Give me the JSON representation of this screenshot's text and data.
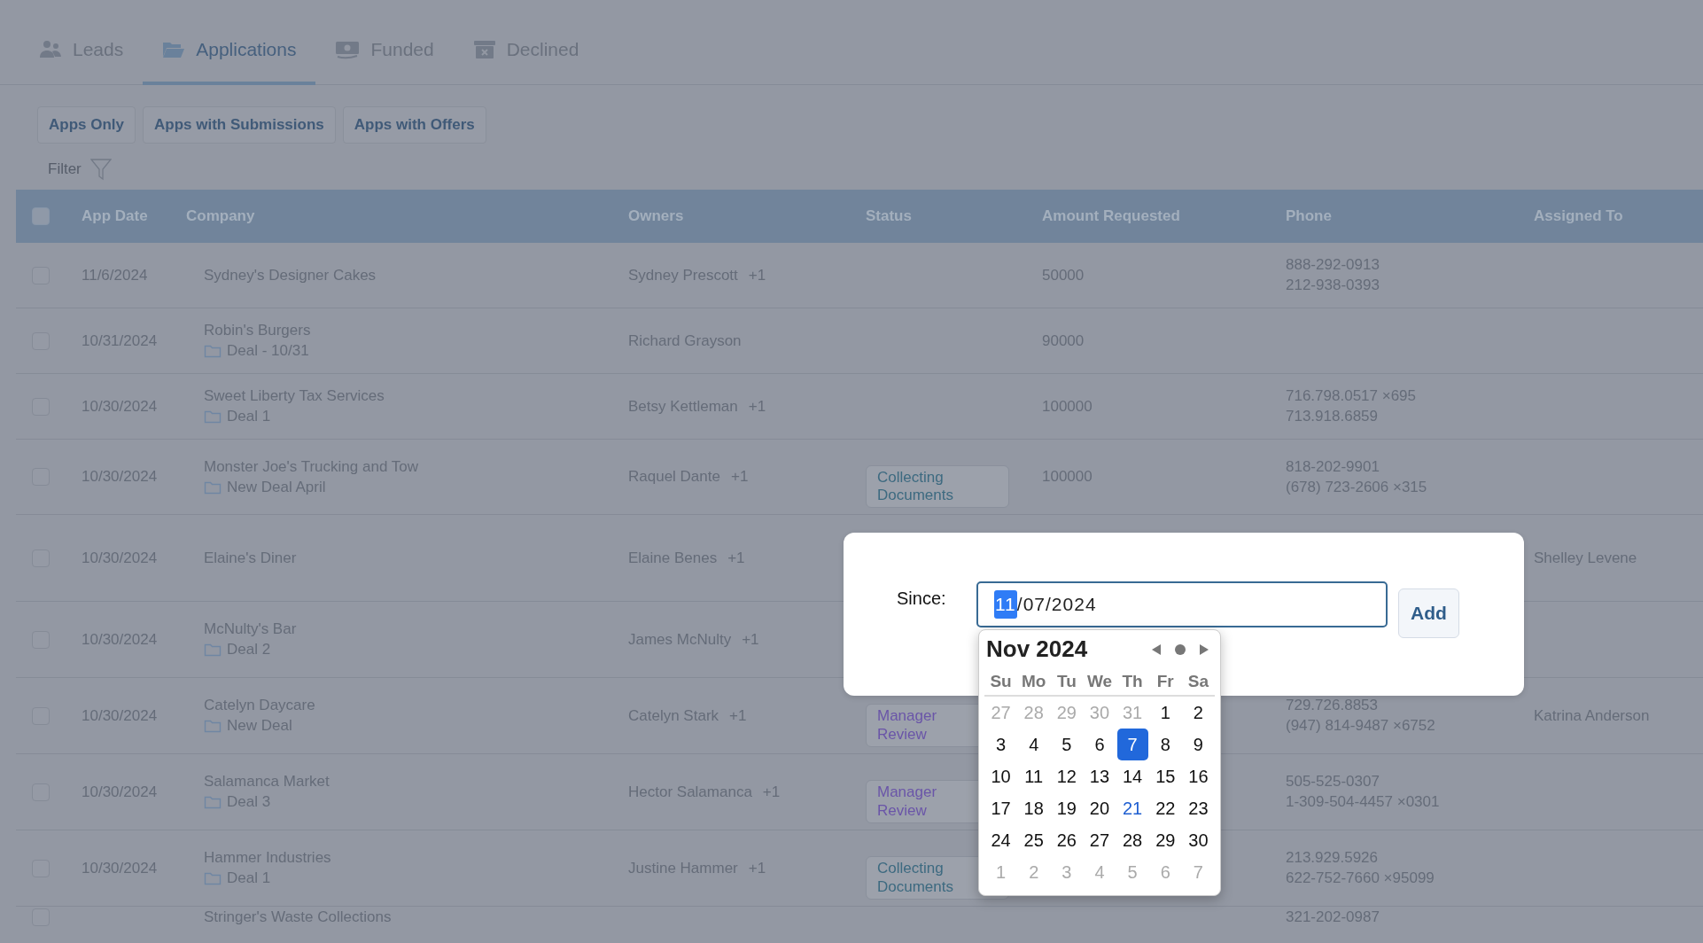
{
  "tabs": [
    {
      "label": "Leads",
      "selected": false
    },
    {
      "label": "Applications",
      "selected": true
    },
    {
      "label": "Funded",
      "selected": false
    },
    {
      "label": "Declined",
      "selected": false
    }
  ],
  "segments": [
    "Apps Only",
    "Apps with Submissions",
    "Apps with Offers"
  ],
  "filter": {
    "label": "Filter"
  },
  "table": {
    "all_checked": false,
    "columns": [
      "App Date",
      "Company",
      "Owners",
      "Status",
      "Amount Requested",
      "Phone",
      "Assigned To"
    ],
    "rows": [
      {
        "checked": false,
        "date": "11/6/2024",
        "company": "Sydney's Designer Cakes",
        "owner": "Sydney Prescott",
        "owner_extra": "+1",
        "amount": "50000",
        "phones": [
          "888-292-0913",
          "212-938-0393"
        ]
      },
      {
        "checked": false,
        "date": "10/31/2024",
        "company": "Robin's Burgers",
        "deal": "Deal - 10/31",
        "owner": "Richard Grayson",
        "amount": "90000"
      },
      {
        "checked": false,
        "date": "10/30/2024",
        "company": "Sweet Liberty Tax Services",
        "deal": "Deal 1",
        "owner": "Betsy Kettleman",
        "owner_extra": "+1",
        "amount": "100000",
        "phones": [
          "716.798.0517 ×695",
          "713.918.6859"
        ]
      },
      {
        "checked": false,
        "date": "10/30/2024",
        "company": "Monster Joe's Trucking and Tow",
        "deal": "New Deal April",
        "owner": "Raquel Dante",
        "owner_extra": "+1",
        "status": {
          "label": "Collecting Documents",
          "color": "#3d6a80"
        },
        "amount": "100000",
        "phones": [
          "818-202-9901",
          "(678) 723-2606 ×315"
        ]
      },
      {
        "checked": false,
        "date": "10/30/2024",
        "company": "Elaine's Diner",
        "owner": "Elaine Benes",
        "owner_extra": "+1",
        "assigned": "Shelley Levene"
      },
      {
        "checked": false,
        "date": "10/30/2024",
        "company": "McNulty's Bar",
        "deal": "Deal 2",
        "owner": "James McNulty",
        "owner_extra": "+1"
      },
      {
        "checked": false,
        "date": "10/30/2024",
        "company": "Catelyn Daycare",
        "deal": "New Deal",
        "owner": "Catelyn Stark",
        "owner_extra": "+1",
        "status": {
          "label": "Manager Review",
          "color": "#6a55a8"
        },
        "phones": [
          "729.726.8853",
          "(947) 814-9487 ×6752"
        ],
        "assigned": "Katrina Anderson"
      },
      {
        "checked": false,
        "date": "10/30/2024",
        "company": "Salamanca Market",
        "deal": "Deal 3",
        "owner": "Hector Salamanca",
        "owner_extra": "+1",
        "status": {
          "label": "Manager Review",
          "color": "#6a55a8"
        },
        "phones": [
          "505-525-0307",
          "1-309-504-4457 ×0301"
        ]
      },
      {
        "checked": false,
        "date": "10/30/2024",
        "company": "Hammer Industries",
        "deal": "Deal 1",
        "owner": "Justine Hammer",
        "owner_extra": "+1",
        "status": {
          "label": "Collecting Documents",
          "color": "#3d6a80"
        },
        "phones": [
          "213.929.5926",
          "622-752-7660 ×95099"
        ]
      },
      {
        "checked": false,
        "company": "Stringer's Waste Collections",
        "phones": [
          "321-202-0987"
        ]
      }
    ]
  },
  "dialog": {
    "label": "Since:",
    "field_segments": [
      {
        "text": "11",
        "selected": true
      },
      {
        "text": "/07/2024",
        "selected": false
      }
    ],
    "button": "Add"
  },
  "calendar": {
    "title": "Nov 2024",
    "weekdays": [
      "Su",
      "Mo",
      "Tu",
      "We",
      "Th",
      "Fr",
      "Sa"
    ],
    "weeks": [
      [
        {
          "label": "27",
          "muted": true,
          "selected": false,
          "today": false
        },
        {
          "label": "28",
          "muted": true,
          "selected": false,
          "today": false
        },
        {
          "label": "29",
          "muted": true,
          "selected": false,
          "today": false
        },
        {
          "label": "30",
          "muted": true,
          "selected": false,
          "today": false
        },
        {
          "label": "31",
          "muted": true,
          "selected": false,
          "today": false
        },
        {
          "label": "1",
          "muted": false,
          "selected": false,
          "today": false
        },
        {
          "label": "2",
          "muted": false,
          "selected": false,
          "today": false
        }
      ],
      [
        {
          "label": "3",
          "muted": false,
          "selected": false,
          "today": false
        },
        {
          "label": "4",
          "muted": false,
          "selected": false,
          "today": false
        },
        {
          "label": "5",
          "muted": false,
          "selected": false,
          "today": false
        },
        {
          "label": "6",
          "muted": false,
          "selected": false,
          "today": false
        },
        {
          "label": "7",
          "muted": false,
          "selected": true,
          "today": false
        },
        {
          "label": "8",
          "muted": false,
          "selected": false,
          "today": false
        },
        {
          "label": "9",
          "muted": false,
          "selected": false,
          "today": false
        }
      ],
      [
        {
          "label": "10",
          "muted": false,
          "selected": false,
          "today": false
        },
        {
          "label": "11",
          "muted": false,
          "selected": false,
          "today": false
        },
        {
          "label": "12",
          "muted": false,
          "selected": false,
          "today": false
        },
        {
          "label": "13",
          "muted": false,
          "selected": false,
          "today": false
        },
        {
          "label": "14",
          "muted": false,
          "selected": false,
          "today": false
        },
        {
          "label": "15",
          "muted": false,
          "selected": false,
          "today": false
        },
        {
          "label": "16",
          "muted": false,
          "selected": false,
          "today": false
        }
      ],
      [
        {
          "label": "17",
          "muted": false,
          "selected": false,
          "today": false
        },
        {
          "label": "18",
          "muted": false,
          "selected": false,
          "today": false
        },
        {
          "label": "19",
          "muted": false,
          "selected": false,
          "today": false
        },
        {
          "label": "20",
          "muted": false,
          "selected": false,
          "today": false
        },
        {
          "label": "21",
          "muted": false,
          "selected": false,
          "today": true
        },
        {
          "label": "22",
          "muted": false,
          "selected": false,
          "today": false
        },
        {
          "label": "23",
          "muted": false,
          "selected": false,
          "today": false
        }
      ],
      [
        {
          "label": "24",
          "muted": false,
          "selected": false,
          "today": false
        },
        {
          "label": "25",
          "muted": false,
          "selected": false,
          "today": false
        },
        {
          "label": "26",
          "muted": false,
          "selected": false,
          "today": false
        },
        {
          "label": "27",
          "muted": false,
          "selected": false,
          "today": false
        },
        {
          "label": "28",
          "muted": false,
          "selected": false,
          "today": false
        },
        {
          "label": "29",
          "muted": false,
          "selected": false,
          "today": false
        },
        {
          "label": "30",
          "muted": false,
          "selected": false,
          "today": false
        }
      ],
      [
        {
          "label": "1",
          "muted": true,
          "selected": false,
          "today": false
        },
        {
          "label": "2",
          "muted": true,
          "selected": false,
          "today": false
        },
        {
          "label": "3",
          "muted": true,
          "selected": false,
          "today": false
        },
        {
          "label": "4",
          "muted": true,
          "selected": false,
          "today": false
        },
        {
          "label": "5",
          "muted": true,
          "selected": false,
          "today": false
        },
        {
          "label": "6",
          "muted": true,
          "selected": false,
          "today": false
        },
        {
          "label": "7",
          "muted": true,
          "selected": false,
          "today": false
        }
      ]
    ]
  }
}
